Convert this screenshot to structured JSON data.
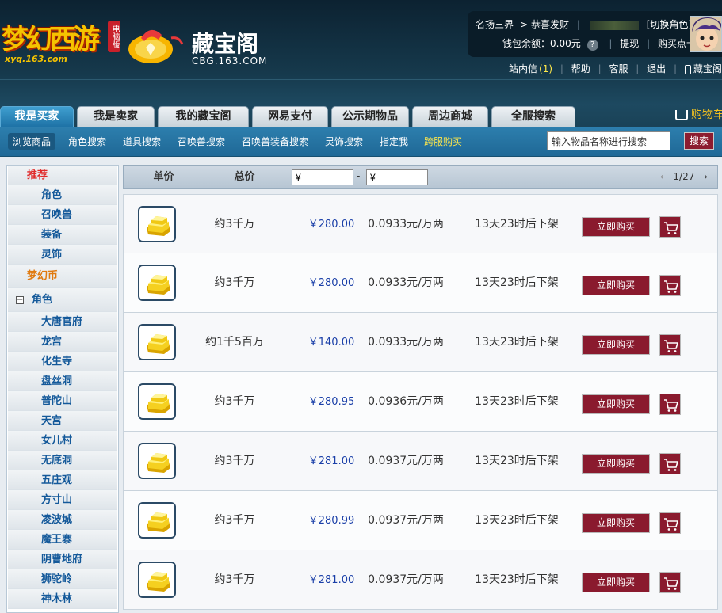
{
  "header": {
    "game_logo_text": "梦幻西游",
    "game_logo_badge": "电脑版",
    "game_logo_url": "xyq.163.com",
    "cbg_name": "藏宝阁",
    "cbg_url": "CBG.163.COM",
    "server_info": "名扬三界 -> 恭喜发财",
    "switch_role": "[切换角色]",
    "wallet_label": "钱包余额：0.00元",
    "withdraw": "提现",
    "buy_card": "购买点卡",
    "qmark": "?",
    "links": {
      "messages": "站内信",
      "messages_count": "(1)",
      "help": "帮助",
      "service": "客服",
      "logout": "退出",
      "app": "藏宝阁APP"
    }
  },
  "tabs": [
    "我是买家",
    "我是卖家",
    "我的藏宝阁",
    "网易支付",
    "公示期物品",
    "周边商城",
    "全服搜索"
  ],
  "cart_label": "购物车",
  "subnav": [
    "浏览商品",
    "角色搜索",
    "道具搜索",
    "召唤兽搜索",
    "召唤兽装备搜索",
    "灵饰搜索",
    "指定我",
    "跨服购买"
  ],
  "search": {
    "placeholder": "输入物品名称进行搜索",
    "button": "搜索"
  },
  "sidebar": {
    "recommend": "推荐",
    "recommend_items": [
      "角色",
      "召唤兽",
      "装备",
      "灵饰"
    ],
    "currency": "梦幻币",
    "category": "角色",
    "category_toggle": "−",
    "schools": [
      "大唐官府",
      "龙宫",
      "化生寺",
      "盘丝洞",
      "普陀山",
      "天宫",
      "女儿村",
      "无底洞",
      "五庄观",
      "方寸山",
      "凌波城",
      "魔王寨",
      "阴曹地府",
      "狮驼岭",
      "神木林"
    ]
  },
  "table": {
    "col_unit_price": "单价",
    "col_total_price": "总价",
    "price_min": "¥",
    "price_max": "¥",
    "range_dash": "-",
    "pager_prev": "‹",
    "pager_text": "1/27",
    "pager_next": "›",
    "buy_label": "立即购买",
    "rows": [
      {
        "amount": "约3千万",
        "price": "￥280.00",
        "unit": "0.0933元/万两",
        "time": "13天23时后下架"
      },
      {
        "amount": "约3千万",
        "price": "￥280.00",
        "unit": "0.0933元/万两",
        "time": "13天23时后下架"
      },
      {
        "amount": "约1千5百万",
        "price": "￥140.00",
        "unit": "0.0933元/万两",
        "time": "13天23时后下架"
      },
      {
        "amount": "约3千万",
        "price": "￥280.95",
        "unit": "0.0936元/万两",
        "time": "13天23时后下架"
      },
      {
        "amount": "约3千万",
        "price": "￥281.00",
        "unit": "0.0937元/万两",
        "time": "13天23时后下架"
      },
      {
        "amount": "约3千万",
        "price": "￥280.99",
        "unit": "0.0937元/万两",
        "time": "13天23时后下架"
      },
      {
        "amount": "约3千万",
        "price": "￥281.00",
        "unit": "0.0937元/万两",
        "time": "13天23时后下架"
      }
    ]
  }
}
